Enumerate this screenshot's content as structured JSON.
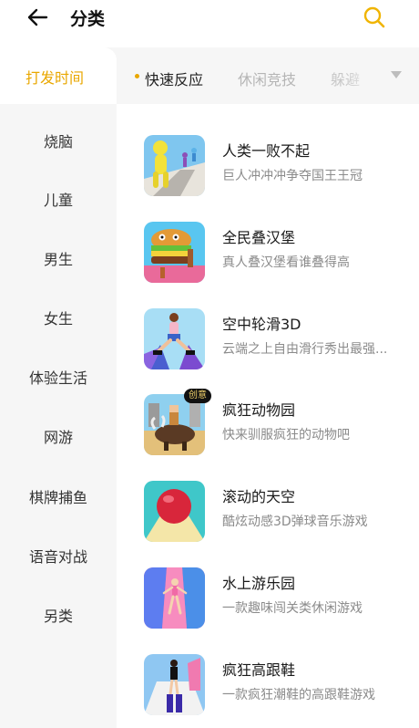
{
  "header": {
    "title": "分类"
  },
  "tabs": {
    "primary": "打发时间",
    "secondary": [
      "快速反应",
      "休闲竞技",
      "躲避"
    ],
    "active_index": 0
  },
  "sidebar": {
    "items": [
      "烧脑",
      "儿童",
      "男生",
      "女生",
      "体验生活",
      "网游",
      "棋牌捕鱼",
      "语音对战",
      "另类"
    ]
  },
  "games": [
    {
      "title": "人类一败不起",
      "desc": "巨人冲冲冲争夺国王王冠",
      "icon": "giant-runner-icon",
      "badge": ""
    },
    {
      "title": "全民叠汉堡",
      "desc": "真人叠汉堡看谁叠得高",
      "icon": "burger-stack-icon",
      "badge": ""
    },
    {
      "title": "空中轮滑3D",
      "desc": "云端之上自由滑行秀出最强...",
      "icon": "sky-roller-icon",
      "badge": ""
    },
    {
      "title": "疯狂动物园",
      "desc": "快来驯服疯狂的动物吧",
      "icon": "crazy-zoo-icon",
      "badge": "创意"
    },
    {
      "title": "滚动的天空",
      "desc": "酷炫动感3D弹球音乐游戏",
      "icon": "rolling-sky-icon",
      "badge": ""
    },
    {
      "title": "水上游乐园",
      "desc": "一款趣味闯关类休闲游戏",
      "icon": "water-park-icon",
      "badge": ""
    },
    {
      "title": "疯狂高跟鞋",
      "desc": "一款疯狂潮鞋的高跟鞋游戏",
      "icon": "high-heels-icon",
      "badge": ""
    }
  ],
  "colors": {
    "accent": "#e9a700",
    "sidebar_bg": "#f6f6f6",
    "muted_text": "#8b8b8b"
  }
}
